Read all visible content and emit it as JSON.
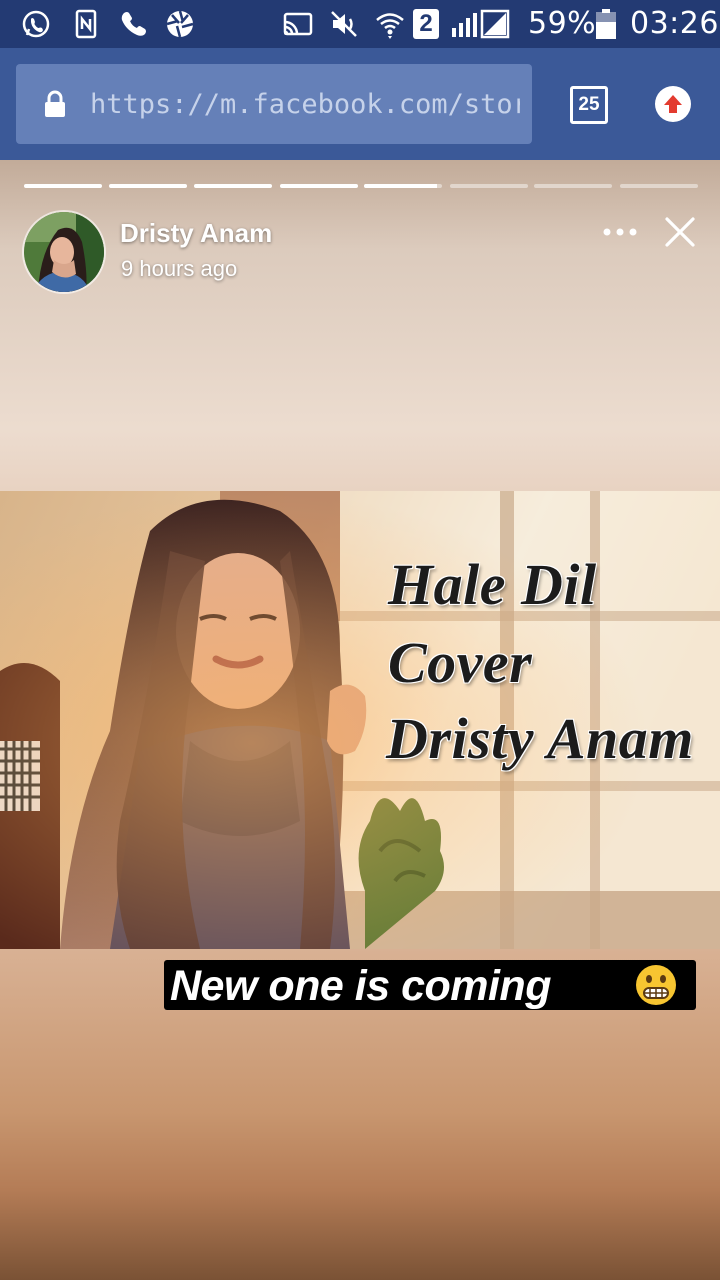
{
  "status_bar": {
    "battery_percent": "59%",
    "time": "03:26",
    "sim_slot": "2",
    "icons": [
      "whatsapp-icon",
      "nfc-icon",
      "phone-icon",
      "aperture-icon",
      "cast-icon",
      "mute-icon",
      "wifi-icon",
      "sim-2-icon",
      "signal-icon",
      "battery-icon"
    ]
  },
  "browser": {
    "url": "https://m.facebook.com/stories",
    "tab_count": "25",
    "icons": [
      "lock-icon",
      "tabs-icon",
      "upload-icon"
    ]
  },
  "story": {
    "progress_segments": [
      1,
      1,
      1,
      1,
      0.93,
      0,
      0,
      0
    ],
    "author_name": "Dristy Anam",
    "time_ago": "9 hours ago",
    "photo_title_lines": [
      "Hale Dil",
      "Cover",
      "Dristy Anam"
    ],
    "caption": "New one is coming",
    "caption_emoji": "grimacing-face-emoji",
    "icons": [
      "more-icon",
      "close-icon"
    ]
  },
  "colors": {
    "status_bar_bg": "#233a73",
    "browser_bar_bg": "#3b5998",
    "url_field_bg": "#6580b8"
  }
}
